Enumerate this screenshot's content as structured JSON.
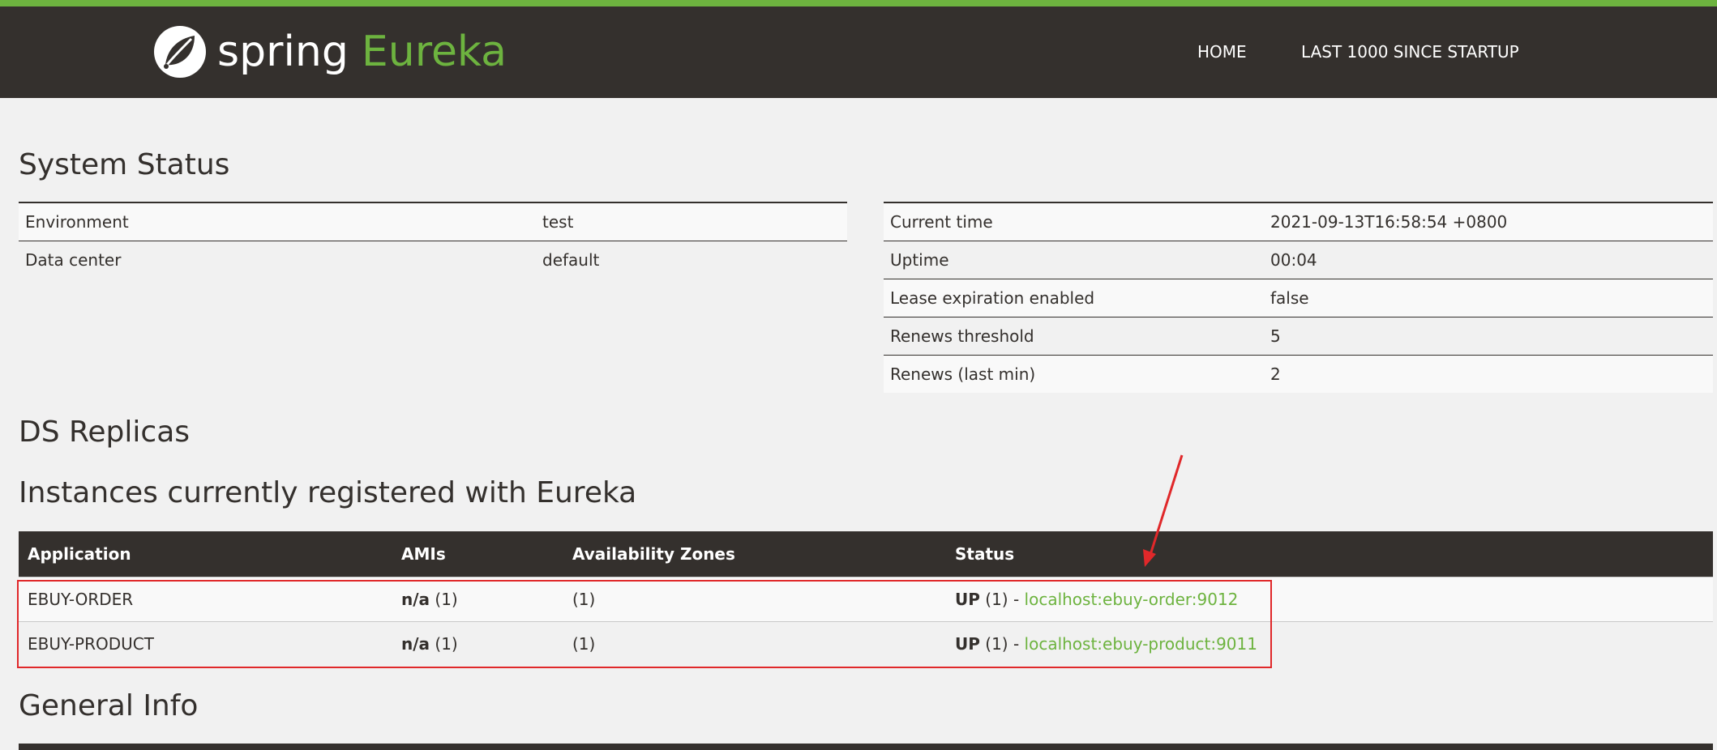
{
  "brand": {
    "word1": "spring",
    "word2": "Eureka",
    "icon": "spring-leaf-icon",
    "accent_color": "#6db33f",
    "nav_bg": "#34302d"
  },
  "nav": {
    "home": "HOME",
    "last": "LAST 1000 SINCE STARTUP"
  },
  "system_status": {
    "title": "System Status",
    "left": [
      {
        "key": "Environment",
        "value": "test"
      },
      {
        "key": "Data center",
        "value": "default"
      }
    ],
    "right": [
      {
        "key": "Current time",
        "value": "2021-09-13T16:58:54 +0800"
      },
      {
        "key": "Uptime",
        "value": "00:04"
      },
      {
        "key": "Lease expiration enabled",
        "value": "false"
      },
      {
        "key": "Renews threshold",
        "value": "5"
      },
      {
        "key": "Renews (last min)",
        "value": "2"
      }
    ]
  },
  "ds_replicas": {
    "title": "DS Replicas"
  },
  "instances": {
    "title": "Instances currently registered with Eureka",
    "headers": [
      "Application",
      "AMIs",
      "Availability Zones",
      "Status"
    ],
    "rows": [
      {
        "app": "EBUY-ORDER",
        "ami_label": "n/a",
        "ami_count": "(1)",
        "zones": "(1)",
        "status": "UP",
        "status_count": "(1) -",
        "link": "localhost:ebuy-order:9012"
      },
      {
        "app": "EBUY-PRODUCT",
        "ami_label": "n/a",
        "ami_count": "(1)",
        "zones": "(1)",
        "status": "UP",
        "status_count": "(1) -",
        "link": "localhost:ebuy-product:9011"
      }
    ]
  },
  "general_info": {
    "title": "General Info"
  },
  "annotation": {
    "box_color": "#e0282a"
  }
}
